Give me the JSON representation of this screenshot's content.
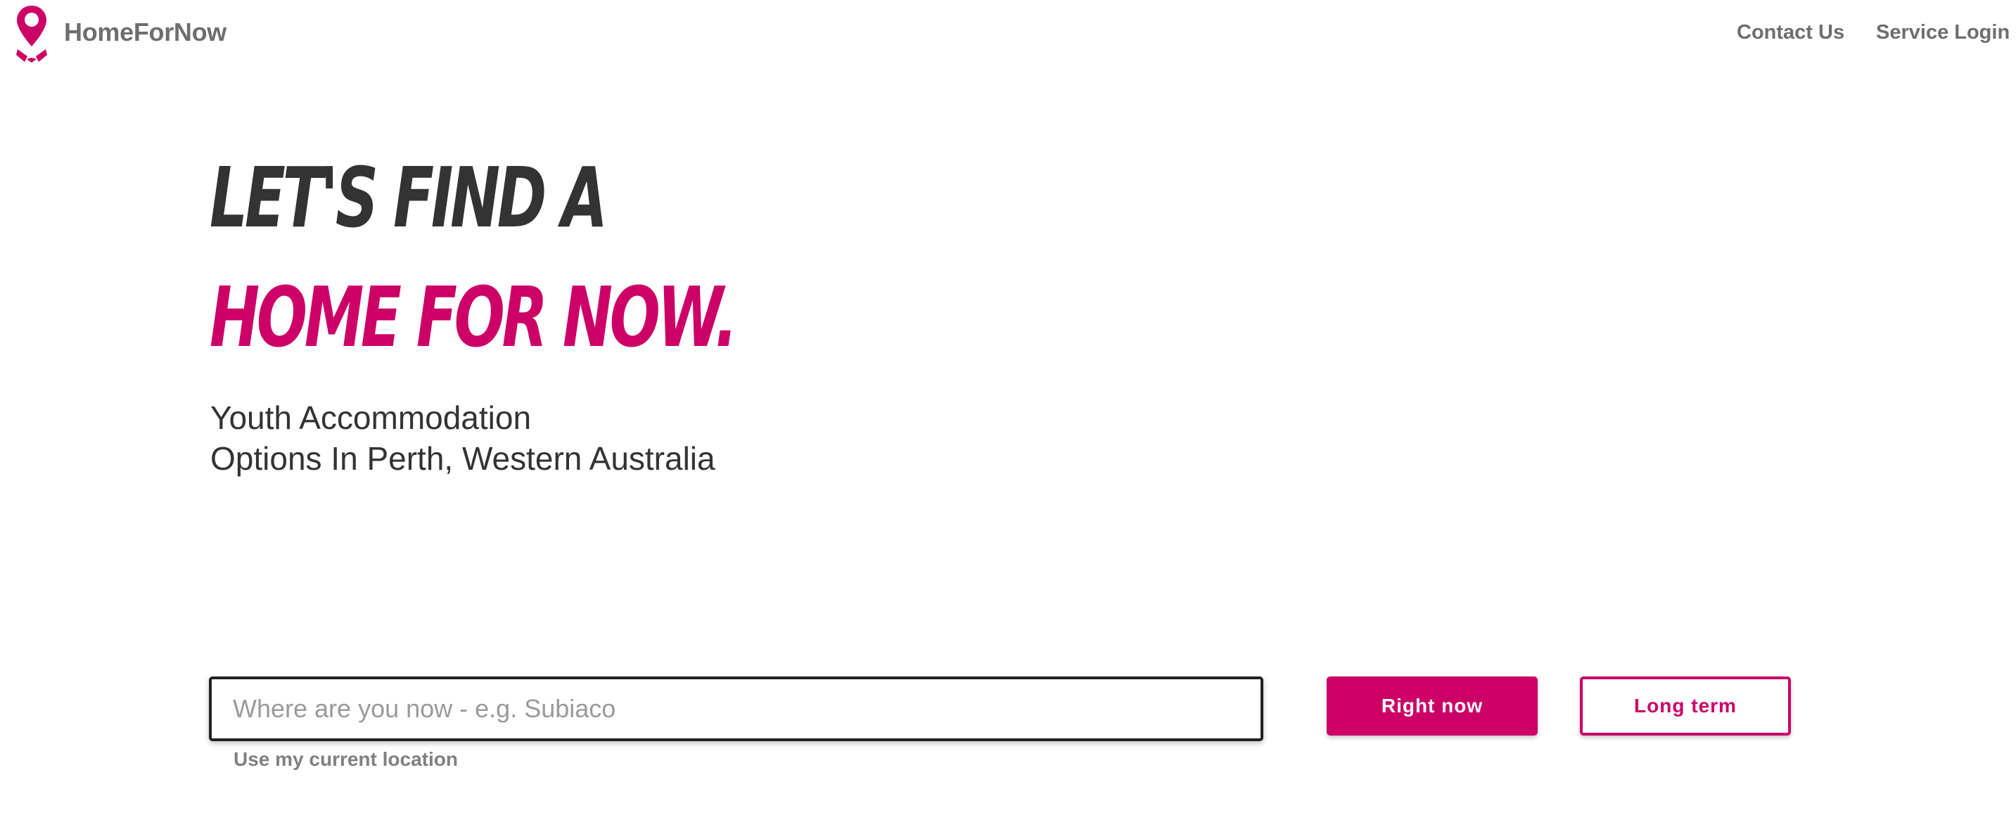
{
  "header": {
    "brand_name": "HomeForNow",
    "nav": {
      "contact": "Contact Us",
      "service_login": "Service Login"
    },
    "logo_icon": "map-pin-with-hands-icon"
  },
  "hero": {
    "line1": "LET'S FIND A",
    "line2": "HOME FOR NOW.",
    "subtitle_line1": "Youth Accommodation",
    "subtitle_line2": "Options In Perth, Western Australia"
  },
  "search": {
    "placeholder": "Where are you now - e.g. Subiaco",
    "value": "",
    "location_link": "Use my current location"
  },
  "buttons": {
    "right_now": "Right now",
    "long_term": "Long term"
  },
  "colors": {
    "brand": "#cc0066",
    "heading_dark": "#333333",
    "nav_text": "#6e6e6e",
    "muted_text": "#808080"
  }
}
